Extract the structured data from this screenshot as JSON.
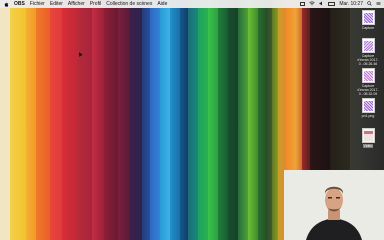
{
  "menubar": {
    "app_name": "OBS",
    "menus": [
      "Fichier",
      "Editer",
      "Afficher",
      "Profil",
      "Collection de scènes",
      "Aide"
    ],
    "clock": "Mar. 10:27",
    "icons": [
      "apple-icon",
      "display-icon",
      "wifi-icon",
      "volume-icon",
      "battery-icon",
      "search-icon",
      "notification-icon"
    ]
  },
  "desktop_icons": [
    {
      "label": "Capture",
      "color": "#9b6bd6"
    },
    {
      "label": "Capture d'écran 2017-0...05.26.46",
      "color": "#b07ad6"
    },
    {
      "label": "Capture d'écran 2017-0...05.32.09",
      "color": "#c27ad4"
    },
    {
      "label": "pn1.png",
      "color": "#a06ad0"
    },
    {
      "label": "Vidéo",
      "color": "#d8b0b0"
    }
  ],
  "webcam": {
    "label": "webcam-feed"
  }
}
